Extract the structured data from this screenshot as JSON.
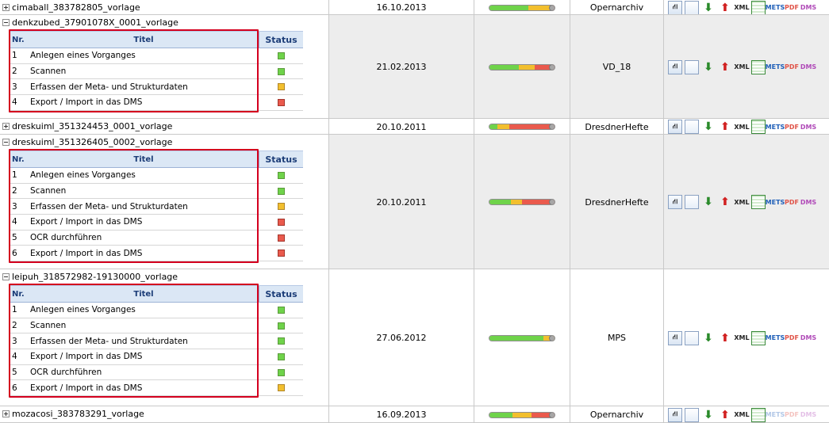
{
  "subtable_headers": {
    "nr": "Nr.",
    "title": "Titel",
    "status": "Status"
  },
  "action_icons": [
    "tree-icon",
    "document-icon",
    "download-arrow-icon",
    "upload-arrow-icon",
    "xml-icon",
    "list-icon",
    "mets-icon",
    "pdf-icon",
    "dms-icon"
  ],
  "action_labels": {
    "xml": "XML",
    "mets": "METS",
    "pdf": "PDF",
    "dms": "DMS"
  },
  "colors": {
    "green": "#6fd34a",
    "yellow": "#f2bf2e",
    "red": "#ea5a4d",
    "highlight": "#d4001e",
    "header_bg": "#dbe7f5"
  },
  "rows": [
    {
      "title": "cimaball_383782805_vorlage",
      "expanded": false,
      "date": "16.10.2013",
      "project": "Opernarchiv",
      "progress": [
        0.6,
        0.35,
        0.05
      ]
    },
    {
      "title": "denkzubed_37901078X_0001_vorlage",
      "expanded": true,
      "date": "21.02.2013",
      "project": "VD_18",
      "progress": [
        0.45,
        0.25,
        0.3
      ],
      "tasks": [
        {
          "nr": "1",
          "title": "Anlegen eines Vorganges",
          "status": "green"
        },
        {
          "nr": "2",
          "title": "Scannen",
          "status": "green"
        },
        {
          "nr": "3",
          "title": "Erfassen der Meta- und Strukturdaten",
          "status": "yellow"
        },
        {
          "nr": "4",
          "title": "Export / Import in das DMS",
          "status": "red"
        }
      ]
    },
    {
      "title": "dreskuiml_351324453_0001_vorlage",
      "expanded": false,
      "date": "20.10.2011",
      "project": "DresdnerHefte",
      "progress": [
        0.12,
        0.18,
        0.7
      ]
    },
    {
      "title": "dreskuiml_351326405_0002_vorlage",
      "expanded": true,
      "date": "20.10.2011",
      "project": "DresdnerHefte",
      "progress": [
        0.33,
        0.17,
        0.5
      ],
      "tasks": [
        {
          "nr": "1",
          "title": "Anlegen eines Vorganges",
          "status": "green"
        },
        {
          "nr": "2",
          "title": "Scannen",
          "status": "green"
        },
        {
          "nr": "3",
          "title": "Erfassen der Meta- und Strukturdaten",
          "status": "yellow"
        },
        {
          "nr": "4",
          "title": "Export / Import in das DMS",
          "status": "red"
        },
        {
          "nr": "5",
          "title": "OCR durchführen",
          "status": "red"
        },
        {
          "nr": "6",
          "title": "Export / Import in das DMS",
          "status": "red"
        }
      ]
    },
    {
      "title": "leipuh_318572982-19130000_vorlage",
      "expanded": true,
      "date": "27.06.2012",
      "project": "MPS",
      "progress": [
        0.83,
        0.17,
        0
      ],
      "tasks": [
        {
          "nr": "1",
          "title": "Anlegen eines Vorganges",
          "status": "green"
        },
        {
          "nr": "2",
          "title": "Scannen",
          "status": "green"
        },
        {
          "nr": "3",
          "title": "Erfassen der Meta- und Strukturdaten",
          "status": "green"
        },
        {
          "nr": "4",
          "title": "Export / Import in das DMS",
          "status": "green"
        },
        {
          "nr": "5",
          "title": "OCR durchführen",
          "status": "green"
        },
        {
          "nr": "6",
          "title": "Export / Import in das DMS",
          "status": "yellow"
        }
      ]
    },
    {
      "title": "mozacosi_383783291_vorlage",
      "expanded": false,
      "date": "16.09.2013",
      "project": "Opernarchiv",
      "progress": [
        0.35,
        0.3,
        0.35
      ]
    }
  ]
}
